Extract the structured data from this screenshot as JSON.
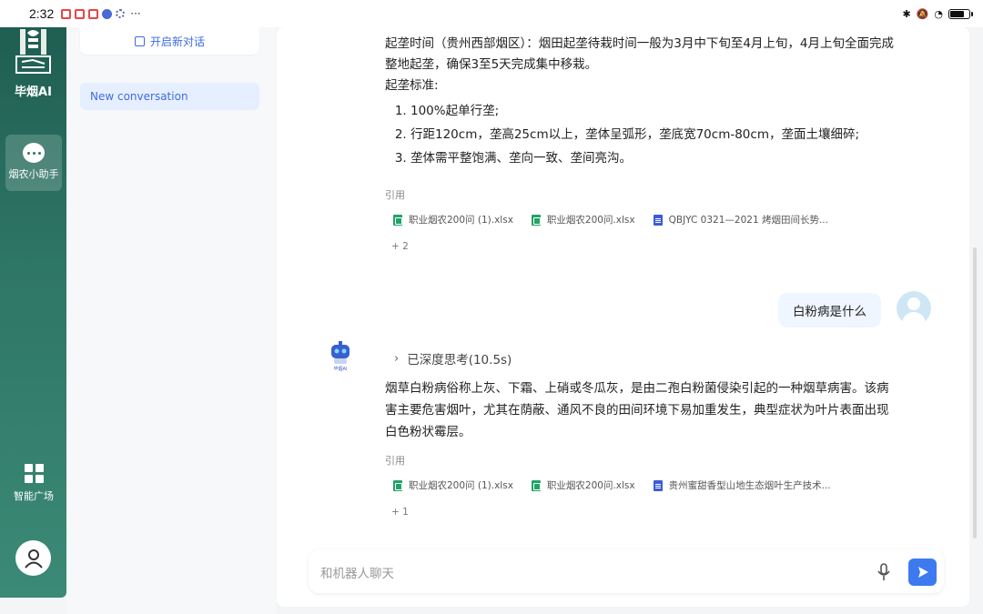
{
  "status_bar": {
    "time": "2:32",
    "more": "···"
  },
  "rail": {
    "brand": "毕烟AI",
    "assistant_label": "烟农小助手",
    "plaza_label": "智能广场"
  },
  "sidebar": {
    "new_chat": "开启新对话",
    "conversations": [
      "New conversation"
    ]
  },
  "messages": {
    "prev_answer": {
      "para1": "起垄时间（贵州西部烟区）：烟田起垄待栽时间一般为3月中下旬至4月上旬，4月上旬全面完成整地起垄，确保3至5天完成集中移栽。",
      "para2": "起垄标准:",
      "list": [
        "100%起单行垄;",
        "行距120cm，垄高25cm以上，垄体呈弧形，垄底宽70cm-80cm，垄面土壤细碎;",
        "垄体需平整饱满、垄向一致、垄间亮沟。"
      ],
      "ref_label": "引用",
      "refs": [
        "职业烟农200问 (1).xlsx",
        "职业烟农200问.xlsx",
        "QBJYC 0321—2021 烤烟田间长势..."
      ],
      "more": "+ 2"
    },
    "user_question": "白粉病是什么",
    "bot_avatar_text": "毕烟AI",
    "thinking": "已深度思考(10.5s)",
    "answer": {
      "text": "烟草白粉病俗称上灰、下霜、上硝或冬瓜灰，是由二孢白粉菌侵染引起的一种烟草病害。该病害主要危害烟叶，尤其在荫蔽、通风不良的田间环境下易加重发生，典型症状为叶片表面出现白色粉状霉层。",
      "ref_label": "引用",
      "refs": [
        "职业烟农200问 (1).xlsx",
        "职业烟农200问.xlsx",
        "贵州蜜甜香型山地生态烟叶生产技术..."
      ],
      "more": "+ 1"
    }
  },
  "input": {
    "placeholder": "和机器人聊天"
  },
  "colors": {
    "rail": "#2e7565",
    "accent": "#3f6be0",
    "send": "#3d7af0"
  }
}
